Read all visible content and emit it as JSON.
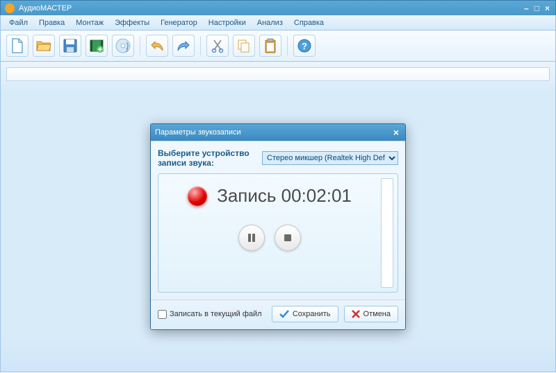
{
  "window": {
    "title": "АудиоМАСТЕР"
  },
  "menu": {
    "items": [
      "Файл",
      "Правка",
      "Монтаж",
      "Эффекты",
      "Генератор",
      "Настройки",
      "Анализ",
      "Справка"
    ]
  },
  "toolbar": {
    "icons": [
      "new-file-icon",
      "open-file-icon",
      "save-icon",
      "add-video-icon",
      "cd-icon",
      "undo-icon",
      "redo-icon",
      "cut-icon",
      "copy-icon",
      "paste-icon",
      "help-icon"
    ]
  },
  "dialog": {
    "title": "Параметры звукозаписи",
    "device_label": "Выберите устройство записи звука:",
    "device_selected": "Стерео микшер (Realtek High Def",
    "record_prefix": "Запись",
    "record_time": "00:02:01",
    "checkbox_label": "Записать в текущий файл",
    "save_label": "Сохранить",
    "cancel_label": "Отмена"
  }
}
